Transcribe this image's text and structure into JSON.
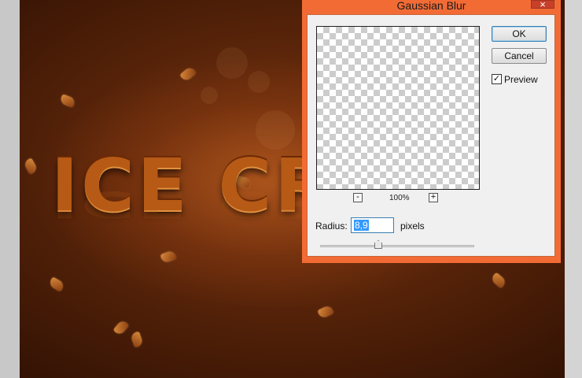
{
  "canvas": {
    "artwork_text": "ICE CR"
  },
  "dialog": {
    "title": "Gaussian Blur",
    "close_glyph": "×",
    "ok_label": "OK",
    "cancel_label": "Cancel",
    "preview_label": "Preview",
    "preview_checked": true,
    "check_glyph": "✓",
    "zoom_out_glyph": "-",
    "zoom_in_glyph": "+",
    "zoom_level": "100%",
    "radius_label": "Radius:",
    "radius_value": "8,9",
    "radius_unit": "pixels"
  },
  "colors": {
    "dialog_frame": "#f26b35",
    "close_button": "#c7402a",
    "selection": "#3399ff"
  }
}
